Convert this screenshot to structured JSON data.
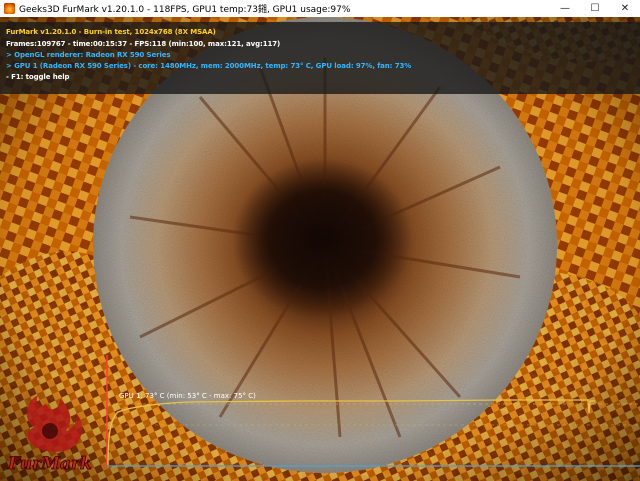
{
  "window": {
    "title": "Geeks3D FurMark v1.20.1.0 - 118FPS, GPU1 temp:73鎺, GPU1 usage:97%",
    "controls": {
      "minimize": "—",
      "maximize": "☐",
      "close": "✕"
    }
  },
  "osd": {
    "line1": "FurMark v1.20.1.0 - Burn-in test, 1024x768 (8X MSAA)",
    "line2": "Frames:109767 - time:00:15:37 - FPS:118 (min:100, max:121, avg:117)",
    "line3": "> OpenGL renderer: Radeon RX 590 Series",
    "line4": "> GPU 1 (Radeon RX 590 Series) - core: 1480MHz, mem: 2000MHz, temp: 73° C, GPU load: 97%, fan: 73%",
    "line5": "- F1: toggle help"
  },
  "temp_graph": {
    "label": "GPU 1: 73° C (min: 53° C - max: 75° C)",
    "current": 73,
    "min": 53,
    "max": 75,
    "line_color": "#e8c24a",
    "axis_color": "#ff3b3b",
    "baseline_color": "#5aa0c8"
  },
  "logo": {
    "text": "FurMark"
  }
}
